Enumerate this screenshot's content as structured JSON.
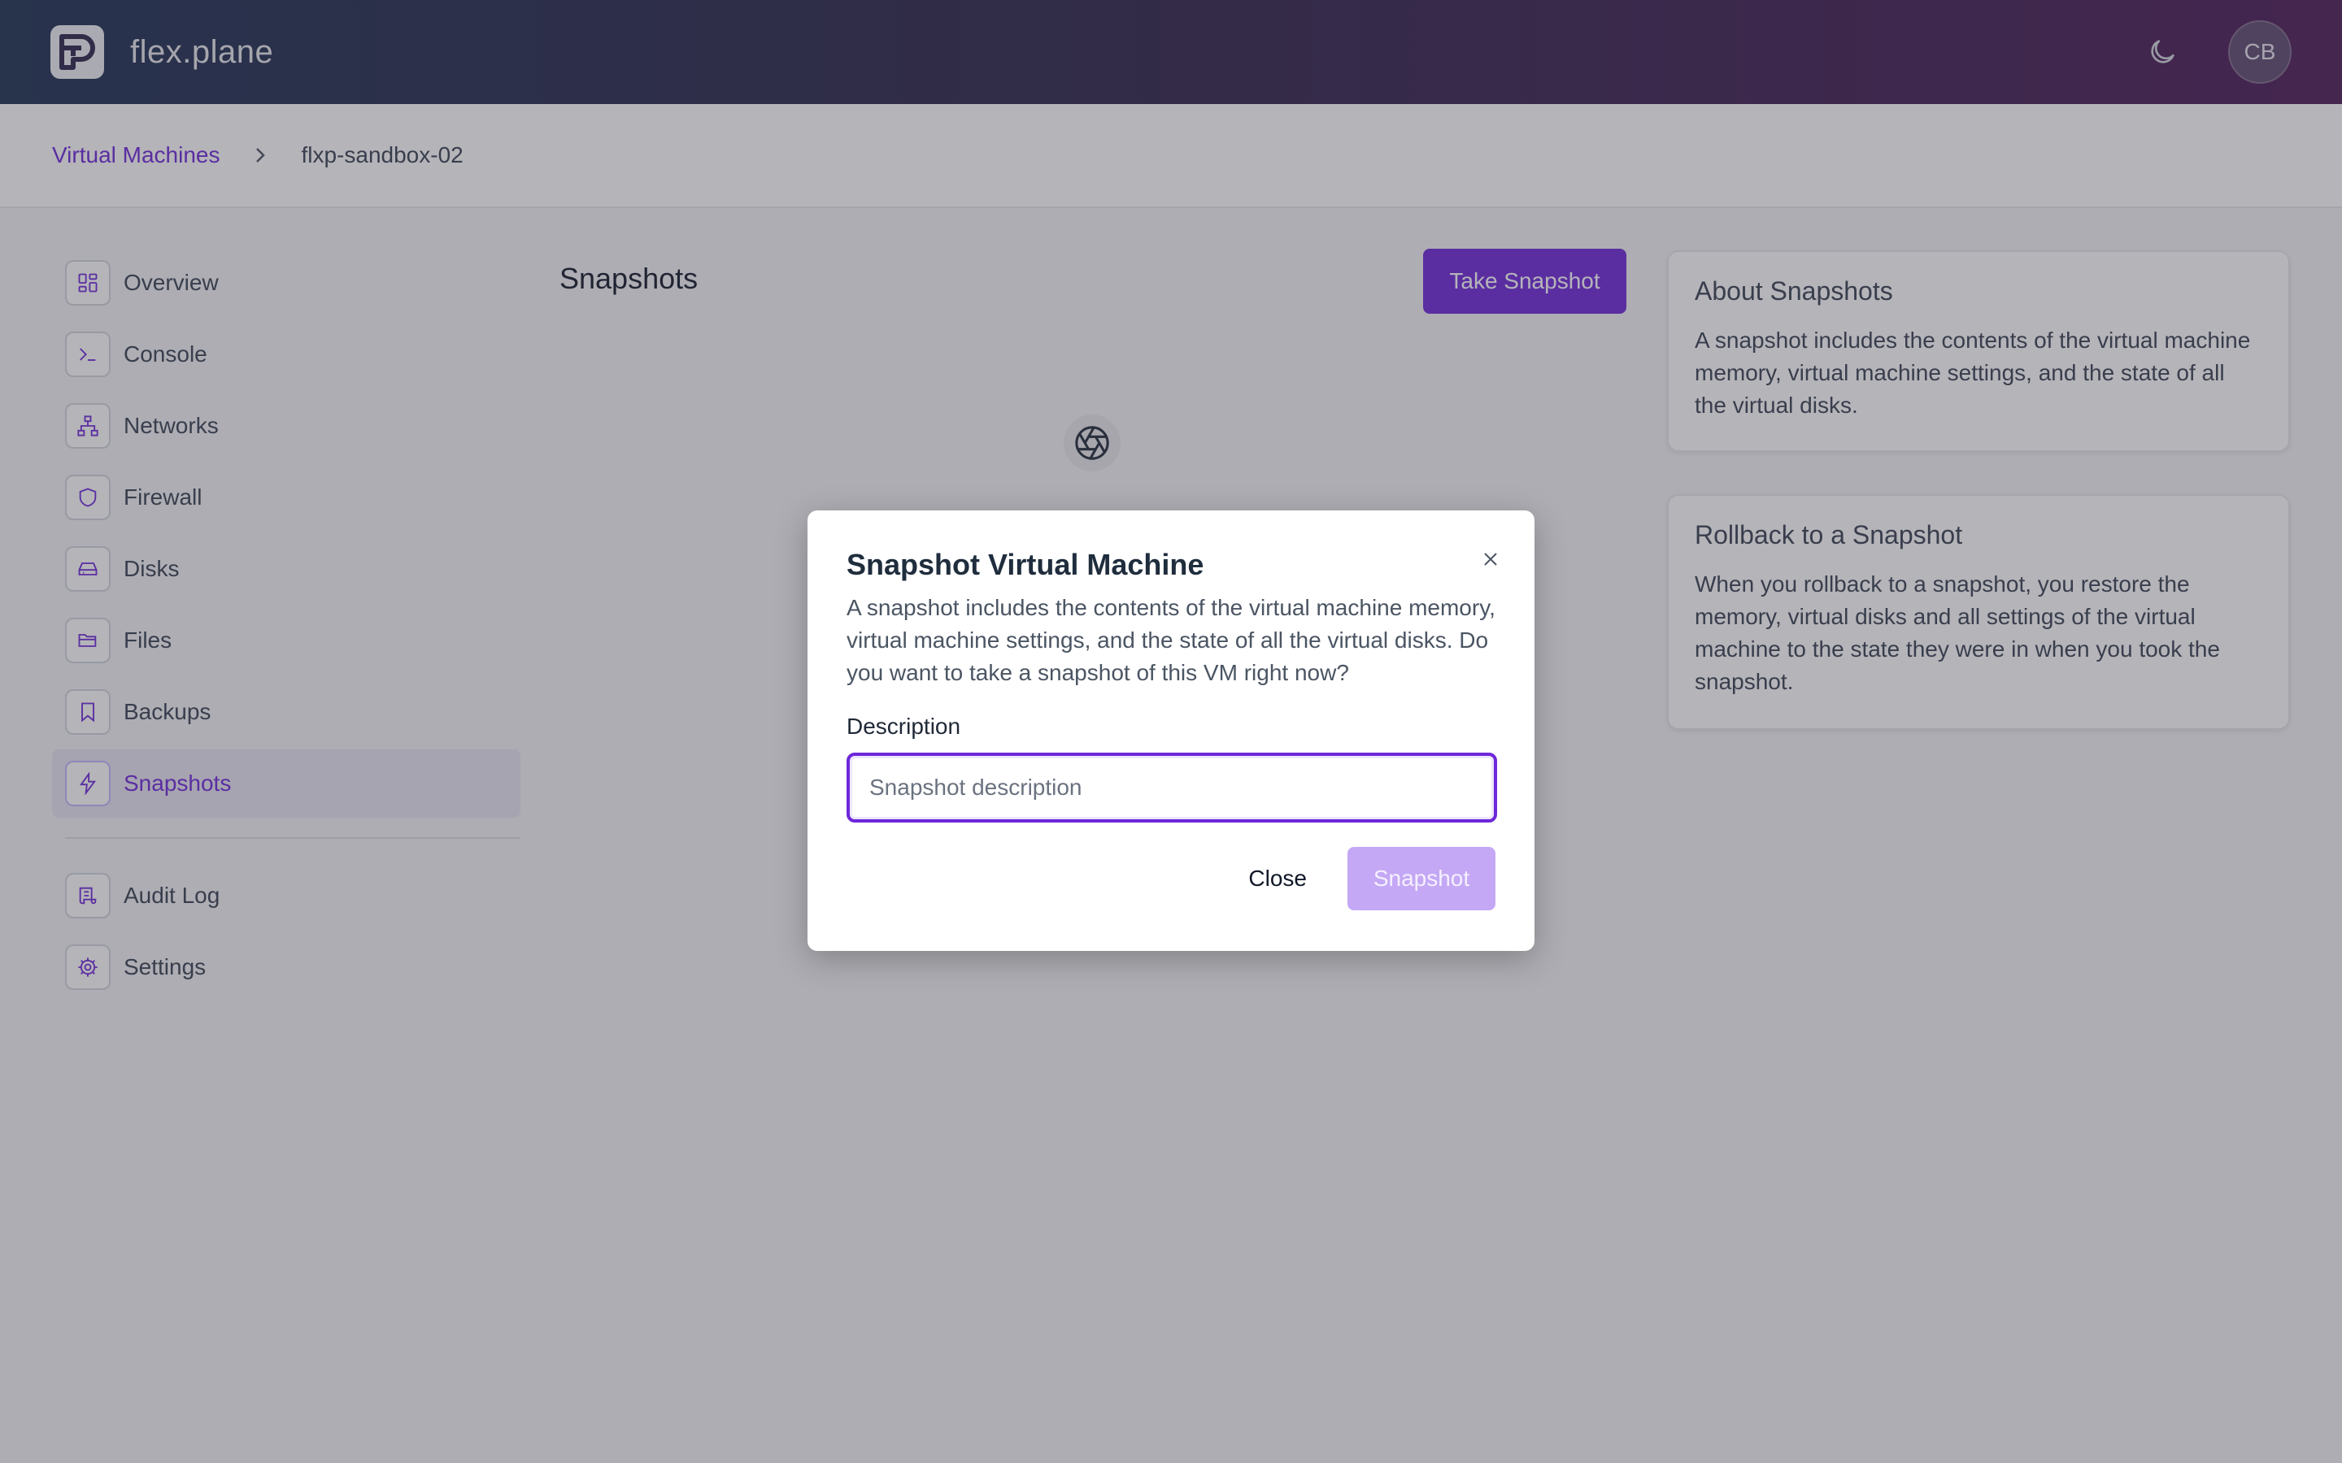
{
  "app": {
    "name": "flex.plane",
    "logo_icon": "flexplane-logo-icon",
    "theme_icon": "moon-icon",
    "user_initials": "CB"
  },
  "breadcrumb": {
    "parent": "Virtual Machines",
    "current": "flxp-sandbox-02"
  },
  "sidebar": {
    "items": [
      {
        "label": "Overview",
        "icon": "grid-icon"
      },
      {
        "label": "Console",
        "icon": "terminal-icon"
      },
      {
        "label": "Networks",
        "icon": "network-icon"
      },
      {
        "label": "Firewall",
        "icon": "shield-icon"
      },
      {
        "label": "Disks",
        "icon": "disk-icon"
      },
      {
        "label": "Files",
        "icon": "folder-icon"
      },
      {
        "label": "Backups",
        "icon": "bookmark-icon"
      },
      {
        "label": "Snapshots",
        "icon": "bolt-icon",
        "active": true
      }
    ],
    "secondary": [
      {
        "label": "Audit Log",
        "icon": "scroll-icon"
      },
      {
        "label": "Settings",
        "icon": "gear-icon"
      }
    ]
  },
  "main": {
    "title": "Snapshots",
    "take_button": "Take Snapshot",
    "empty_icon": "aperture-icon"
  },
  "cards": [
    {
      "title": "About Snapshots",
      "body": "A snapshot includes the contents of the virtual machine memory, virtual machine settings, and the state of all the virtual disks."
    },
    {
      "title": "Rollback to a Snapshot",
      "body": "When you rollback to a snapshot, you restore the memory, virtual disks and all settings of the virtual machine to the state they were in when you took the snapshot."
    }
  ],
  "modal": {
    "title": "Snapshot Virtual Machine",
    "description": "A snapshot includes the contents of the virtual machine memory, virtual machine settings, and the state of all the virtual disks. Do you want to take a snapshot of this VM right now?",
    "field_label": "Description",
    "field_placeholder": "Snapshot description",
    "field_value": "",
    "close_label": "Close",
    "submit_label": "Snapshot"
  },
  "colors": {
    "accent": "#6d28d9",
    "accent_disabled": "#c4a8f5"
  }
}
